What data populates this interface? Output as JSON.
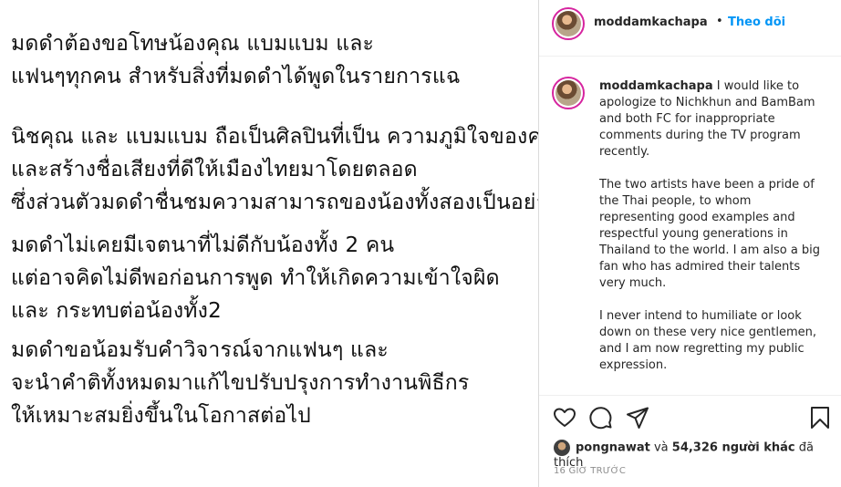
{
  "post_image": {
    "paragraphs": [
      [
        "มดดำต้องขอโทษน้องคุณ แบมแบม และ",
        "แฟนๆทุกคน สำหรับสิ่งที่มดดำได้พูดในรายการแฉ"
      ],
      [
        "นิชคุณ และ แบมแบม ถือเป็นศิลปินที่เป็น ความภูมิใจของคนไทย",
        "และสร้างชื่อเสียงที่ดีให้เมืองไทยมาโดยตลอด",
        "ซึ่งส่วนตัวมดดำชื่นชมความสามารถของน้องทั้งสองเป็นอย่างยิ่ง"
      ],
      [
        "มดดำไม่เคยมีเจตนาที่ไม่ดีกับน้องทั้ง 2 คน",
        "แต่อาจคิดไม่ดีพอก่อนการพูด ทำให้เกิดความเข้าใจผิด",
        " และ กระทบต่อน้องทั้ง2"
      ],
      [
        "มดดำขอน้อมรับคำวิจารณ์จากแฟนๆ และ",
        "จะนำคำติทั้งหมดมาแก้ไขปรับปรุงการทำงานพิธีกร",
        "ให้เหมาะสมยิ่งขึ้นในโอกาสต่อไป"
      ]
    ]
  },
  "header": {
    "username": "moddamkachapa",
    "separator": "•",
    "follow_label": "Theo dõi"
  },
  "caption": {
    "username": "moddamkachapa",
    "first_line": "I would like to apologize to Nichkhun and BamBam and both FC for inappropriate comments during the TV program recently.",
    "paragraph_2": "The two artists have been a pride of the Thai people, to whom representing good examples and respectful young generations in Thailand to the world. I am also a big fan who has admired their talents very much.",
    "paragraph_3": "I never intend to humiliate or look down on these very nice gentlemen, and I am now regretting my public expression."
  },
  "actions": {
    "icons": [
      "heart-icon",
      "comment-icon",
      "share-icon",
      "bookmark-icon"
    ]
  },
  "likes": {
    "user": "pongnawat",
    "connector": "và",
    "count": "54,326 người khác",
    "suffix": "đã thích"
  },
  "timestamp": "16 GIỜ TRƯỚC",
  "colors": {
    "link": "#0095f6",
    "text": "#262626",
    "muted": "#8e8e8e",
    "story_ring": "#d6249f"
  }
}
